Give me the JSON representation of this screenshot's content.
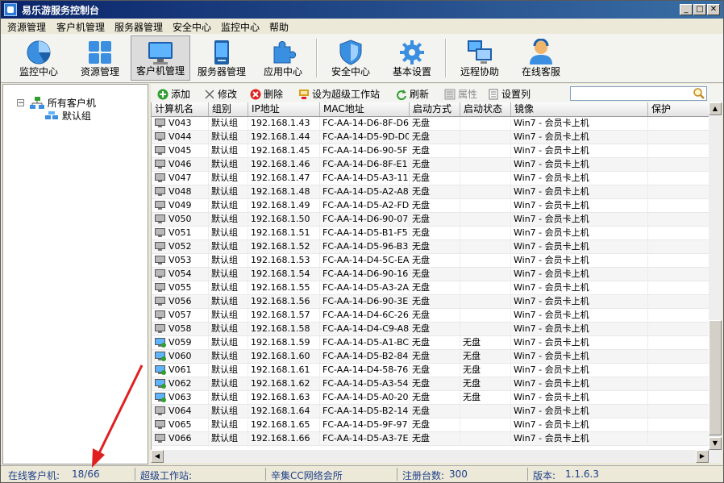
{
  "window": {
    "title": "易乐游服务控制台"
  },
  "menu": [
    "资源管理",
    "客户机管理",
    "服务器管理",
    "安全中心",
    "监控中心",
    "帮助"
  ],
  "toolbar": [
    {
      "label": "监控中心",
      "icon": "pie-chart-icon"
    },
    {
      "label": "资源管理",
      "icon": "grid-tiles-icon"
    },
    {
      "label": "客户机管理",
      "icon": "monitor-icon"
    },
    {
      "label": "服务器管理",
      "icon": "server-icon"
    },
    {
      "label": "应用中心",
      "icon": "puzzle-icon"
    },
    {
      "label": "安全中心",
      "icon": "shield-icon"
    },
    {
      "label": "基本设置",
      "icon": "gear-icon"
    },
    {
      "label": "远程协助",
      "icon": "remote-desktop-icon"
    },
    {
      "label": "在线客服",
      "icon": "user-support-icon"
    }
  ],
  "tree": {
    "root": "所有客户机",
    "child": "默认组"
  },
  "actions": [
    {
      "label": "添加",
      "icon": "add-icon"
    },
    {
      "label": "修改",
      "icon": "edit-icon"
    },
    {
      "label": "删除",
      "icon": "delete-icon"
    },
    {
      "label": "设为超级工作站",
      "icon": "super-workstation-icon"
    },
    {
      "label": "刷新",
      "icon": "refresh-icon"
    },
    {
      "label": "属性",
      "icon": "properties-icon"
    },
    {
      "label": "设置列",
      "icon": "columns-icon"
    }
  ],
  "columns": [
    "计算机名",
    "组别",
    "IP地址",
    "MAC地址",
    "启动方式",
    "启动状态",
    "镜像",
    "保护"
  ],
  "rows": [
    {
      "name": "V043",
      "group": "默认组",
      "ip": "192.168.1.43",
      "mac": "FC-AA-14-D6-8F-D6",
      "boot": "无盘",
      "state": "",
      "image": "Win7 - 会员卡上机",
      "protect": "",
      "online": false
    },
    {
      "name": "V044",
      "group": "默认组",
      "ip": "192.168.1.44",
      "mac": "FC-AA-14-D5-9D-D0",
      "boot": "无盘",
      "state": "",
      "image": "Win7 - 会员卡上机",
      "protect": "",
      "online": false
    },
    {
      "name": "V045",
      "group": "默认组",
      "ip": "192.168.1.45",
      "mac": "FC-AA-14-D6-90-5F",
      "boot": "无盘",
      "state": "",
      "image": "Win7 - 会员卡上机",
      "protect": "",
      "online": false
    },
    {
      "name": "V046",
      "group": "默认组",
      "ip": "192.168.1.46",
      "mac": "FC-AA-14-D6-8F-E1",
      "boot": "无盘",
      "state": "",
      "image": "Win7 - 会员卡上机",
      "protect": "",
      "online": false
    },
    {
      "name": "V047",
      "group": "默认组",
      "ip": "192.168.1.47",
      "mac": "FC-AA-14-D5-A3-11",
      "boot": "无盘",
      "state": "",
      "image": "Win7 - 会员卡上机",
      "protect": "",
      "online": false
    },
    {
      "name": "V048",
      "group": "默认组",
      "ip": "192.168.1.48",
      "mac": "FC-AA-14-D5-A2-A8",
      "boot": "无盘",
      "state": "",
      "image": "Win7 - 会员卡上机",
      "protect": "",
      "online": false
    },
    {
      "name": "V049",
      "group": "默认组",
      "ip": "192.168.1.49",
      "mac": "FC-AA-14-D5-A2-FD",
      "boot": "无盘",
      "state": "",
      "image": "Win7 - 会员卡上机",
      "protect": "",
      "online": false
    },
    {
      "name": "V050",
      "group": "默认组",
      "ip": "192.168.1.50",
      "mac": "FC-AA-14-D6-90-07",
      "boot": "无盘",
      "state": "",
      "image": "Win7 - 会员卡上机",
      "protect": "",
      "online": false
    },
    {
      "name": "V051",
      "group": "默认组",
      "ip": "192.168.1.51",
      "mac": "FC-AA-14-D5-B1-F5",
      "boot": "无盘",
      "state": "",
      "image": "Win7 - 会员卡上机",
      "protect": "",
      "online": false
    },
    {
      "name": "V052",
      "group": "默认组",
      "ip": "192.168.1.52",
      "mac": "FC-AA-14-D5-96-B3",
      "boot": "无盘",
      "state": "",
      "image": "Win7 - 会员卡上机",
      "protect": "",
      "online": false
    },
    {
      "name": "V053",
      "group": "默认组",
      "ip": "192.168.1.53",
      "mac": "FC-AA-14-D4-5C-EA",
      "boot": "无盘",
      "state": "",
      "image": "Win7 - 会员卡上机",
      "protect": "",
      "online": false
    },
    {
      "name": "V054",
      "group": "默认组",
      "ip": "192.168.1.54",
      "mac": "FC-AA-14-D6-90-16",
      "boot": "无盘",
      "state": "",
      "image": "Win7 - 会员卡上机",
      "protect": "",
      "online": false
    },
    {
      "name": "V055",
      "group": "默认组",
      "ip": "192.168.1.55",
      "mac": "FC-AA-14-D5-A3-2A",
      "boot": "无盘",
      "state": "",
      "image": "Win7 - 会员卡上机",
      "protect": "",
      "online": false
    },
    {
      "name": "V056",
      "group": "默认组",
      "ip": "192.168.1.56",
      "mac": "FC-AA-14-D6-90-3E",
      "boot": "无盘",
      "state": "",
      "image": "Win7 - 会员卡上机",
      "protect": "",
      "online": false
    },
    {
      "name": "V057",
      "group": "默认组",
      "ip": "192.168.1.57",
      "mac": "FC-AA-14-D4-6C-26",
      "boot": "无盘",
      "state": "",
      "image": "Win7 - 会员卡上机",
      "protect": "",
      "online": false
    },
    {
      "name": "V058",
      "group": "默认组",
      "ip": "192.168.1.58",
      "mac": "FC-AA-14-D4-C9-A8",
      "boot": "无盘",
      "state": "",
      "image": "Win7 - 会员卡上机",
      "protect": "",
      "online": false
    },
    {
      "name": "V059",
      "group": "默认组",
      "ip": "192.168.1.59",
      "mac": "FC-AA-14-D5-A1-BC",
      "boot": "无盘",
      "state": "无盘",
      "image": "Win7 - 会员卡上机",
      "protect": "",
      "online": true
    },
    {
      "name": "V060",
      "group": "默认组",
      "ip": "192.168.1.60",
      "mac": "FC-AA-14-D5-B2-84",
      "boot": "无盘",
      "state": "无盘",
      "image": "Win7 - 会员卡上机",
      "protect": "",
      "online": true
    },
    {
      "name": "V061",
      "group": "默认组",
      "ip": "192.168.1.61",
      "mac": "FC-AA-14-D4-58-76",
      "boot": "无盘",
      "state": "无盘",
      "image": "Win7 - 会员卡上机",
      "protect": "",
      "online": true
    },
    {
      "name": "V062",
      "group": "默认组",
      "ip": "192.168.1.62",
      "mac": "FC-AA-14-D5-A3-54",
      "boot": "无盘",
      "state": "无盘",
      "image": "Win7 - 会员卡上机",
      "protect": "",
      "online": true
    },
    {
      "name": "V063",
      "group": "默认组",
      "ip": "192.168.1.63",
      "mac": "FC-AA-14-D5-A0-20",
      "boot": "无盘",
      "state": "无盘",
      "image": "Win7 - 会员卡上机",
      "protect": "",
      "online": true
    },
    {
      "name": "V064",
      "group": "默认组",
      "ip": "192.168.1.64",
      "mac": "FC-AA-14-D5-B2-14",
      "boot": "无盘",
      "state": "",
      "image": "Win7 - 会员卡上机",
      "protect": "",
      "online": false
    },
    {
      "name": "V065",
      "group": "默认组",
      "ip": "192.168.1.65",
      "mac": "FC-AA-14-D5-9F-97",
      "boot": "无盘",
      "state": "",
      "image": "Win7 - 会员卡上机",
      "protect": "",
      "online": false
    },
    {
      "name": "V066",
      "group": "默认组",
      "ip": "192.168.1.66",
      "mac": "FC-AA-14-D5-A3-7E",
      "boot": "无盘",
      "state": "",
      "image": "Win7 - 会员卡上机",
      "protect": "",
      "online": false
    }
  ],
  "status": {
    "online_label": "在线客户机:",
    "online_value": "18/66",
    "super_label": "超级工作站:",
    "super_value": "",
    "shop_name": "辛集CC网络会所",
    "registered_label": "注册台数:",
    "registered_value": "300",
    "version_label": "版本:",
    "version_value": "1.1.6.3"
  },
  "colors": {
    "title_bar": "#0a246a",
    "status_text": "#1f3f8a",
    "annotation_arrow": "#e02020",
    "online_icon": "#2f9f2f"
  }
}
